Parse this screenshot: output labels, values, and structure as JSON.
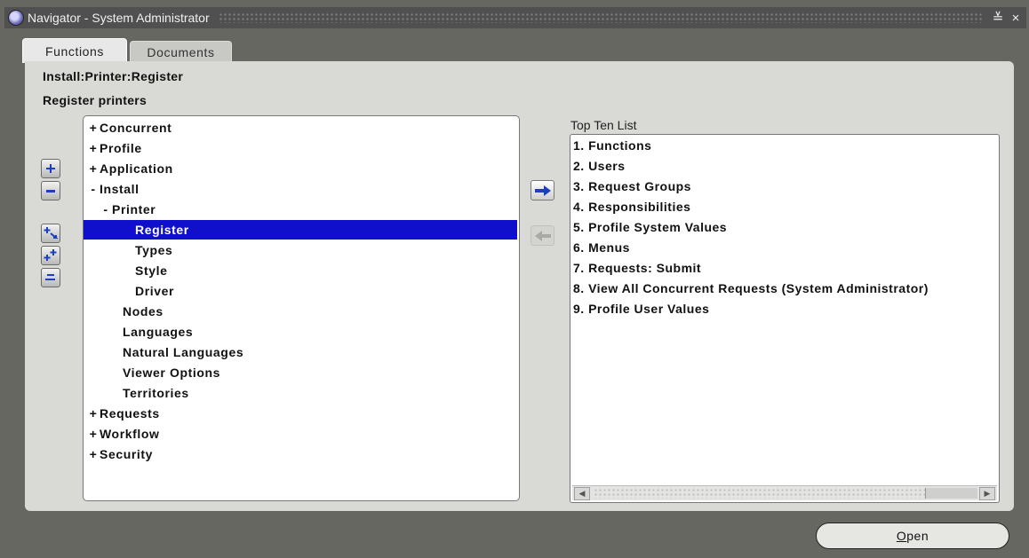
{
  "window": {
    "title": "Navigator - System Administrator",
    "minimize_glyph": "≚",
    "close_glyph": "×"
  },
  "tabs": [
    {
      "label": "Functions",
      "active": true
    },
    {
      "label": "Documents",
      "active": false
    }
  ],
  "breadcrumb": "Install:Printer:Register",
  "description": "Register printers",
  "side_tools": [
    {
      "name": "expand-icon",
      "glyph": "+"
    },
    {
      "name": "collapse-icon",
      "glyph": "−"
    },
    {
      "name": "expand-branch-icon",
      "glyph": "+↘"
    },
    {
      "name": "expand-all-icon",
      "glyph": "+⁺"
    },
    {
      "name": "collapse-all-icon",
      "glyph": "="
    }
  ],
  "tree": [
    {
      "prefix": "+",
      "label": "Concurrent"
    },
    {
      "prefix": "+",
      "label": "Profile"
    },
    {
      "prefix": "+",
      "label": "Application"
    },
    {
      "prefix": "-",
      "label": "Install"
    },
    {
      "prefix": "-",
      "label": "Printer"
    },
    {
      "prefix": "",
      "label": "Register",
      "selected": true
    },
    {
      "prefix": "",
      "label": "Types"
    },
    {
      "prefix": "",
      "label": "Style"
    },
    {
      "prefix": "",
      "label": "Driver"
    },
    {
      "prefix": "",
      "label": "Nodes"
    },
    {
      "prefix": "",
      "label": "Languages"
    },
    {
      "prefix": "",
      "label": "Natural Languages"
    },
    {
      "prefix": "",
      "label": "Viewer Options"
    },
    {
      "prefix": "",
      "label": "Territories"
    },
    {
      "prefix": "+",
      "label": "Requests"
    },
    {
      "prefix": "+",
      "label": "Workflow"
    },
    {
      "prefix": "+",
      "label": "Security"
    }
  ],
  "top_ten": {
    "label": "Top Ten List",
    "items": [
      "1. Functions",
      "2. Users",
      "3. Request Groups",
      "4. Responsibilities",
      "5. Profile System Values",
      "6. Menus",
      "7. Requests: Submit",
      "8. View All Concurrent Requests (System Administrator)",
      "9. Profile User Values"
    ]
  },
  "open_button": {
    "mnemonic": "O",
    "rest": "pen"
  },
  "colors": {
    "selection": "#1010cc",
    "arrow": "#1b3fbf"
  }
}
